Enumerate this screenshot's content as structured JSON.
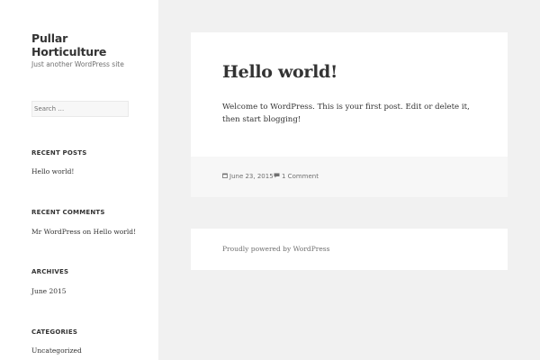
{
  "site": {
    "title": "Pullar Horticulture",
    "description": "Just another WordPress site"
  },
  "search": {
    "placeholder": "Search …"
  },
  "widgets": {
    "recent_posts": {
      "title": "RECENT POSTS",
      "items": [
        "Hello world!"
      ]
    },
    "recent_comments": {
      "title": "RECENT COMMENTS",
      "author": "Mr WordPress",
      "connector": "on",
      "post": "Hello world!"
    },
    "archives": {
      "title": "ARCHIVES",
      "items": [
        "June 2015"
      ]
    },
    "categories": {
      "title": "CATEGORIES",
      "items": [
        "Uncategorized"
      ]
    }
  },
  "post": {
    "title": "Hello world!",
    "content": "Welcome to WordPress. This is your first post. Edit or delete it, then start blogging!",
    "date": "June 23, 2015",
    "comments": "1 Comment",
    "date_icon": "calendar-icon",
    "comments_icon": "comment-icon"
  },
  "footer": {
    "powered_by": "Proudly powered by WordPress"
  },
  "colors": {
    "background": "#f1f1f1",
    "panel": "#ffffff",
    "text": "#333333",
    "muted": "#707070",
    "footer_band": "#f7f7f7"
  }
}
